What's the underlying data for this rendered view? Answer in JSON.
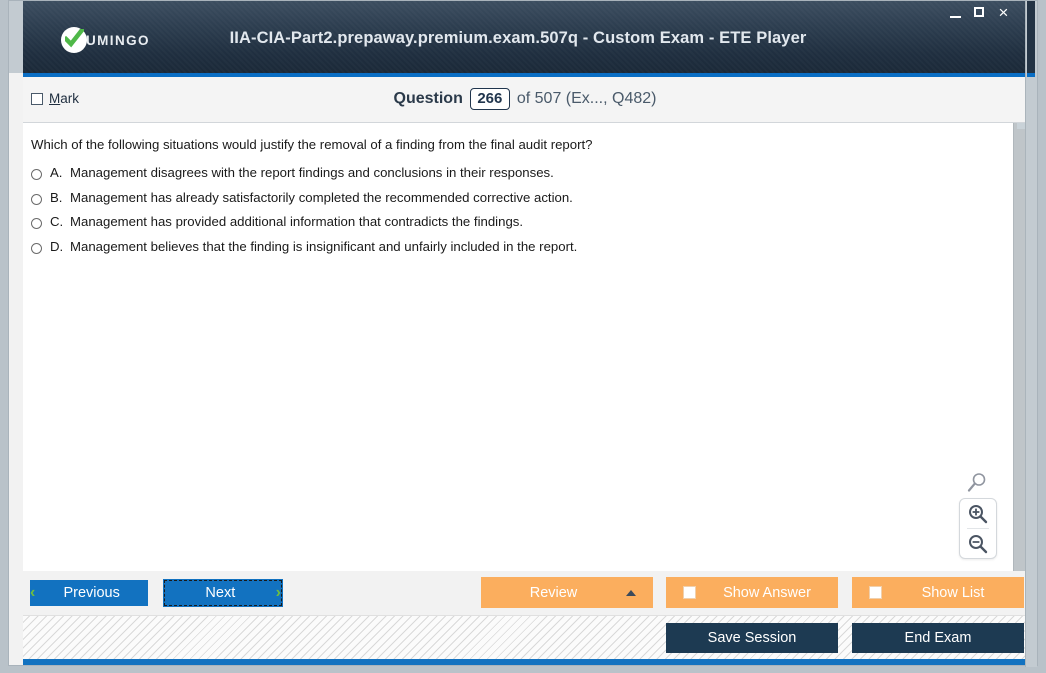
{
  "window": {
    "title": "IIA-CIA-Part2.prepaway.premium.exam.507q - Custom Exam - ETE Player",
    "logo_text": "UMINGO",
    "controls": {
      "minimize": "minimize",
      "maximize": "maximize",
      "close": "×"
    },
    "accent_blue": "#1272c0",
    "titlebar_dark": "#22303f"
  },
  "question_header": {
    "mark_label_accel": "M",
    "mark_label_rest": "ark",
    "question_word": "Question",
    "question_number": "266",
    "of_text": "of 507 (Ex..., Q482)",
    "marked": false
  },
  "question": {
    "prompt": "Which of the following situations would justify the removal of a finding from the final audit report?",
    "options": [
      {
        "letter": "A.",
        "text": "Management disagrees with the report findings and conclusions in their responses.",
        "selected": false
      },
      {
        "letter": "B.",
        "text": "Management has already satisfactorily completed the recommended corrective action.",
        "selected": false
      },
      {
        "letter": "C.",
        "text": "Management has provided additional information that contradicts the findings.",
        "selected": false
      },
      {
        "letter": "D.",
        "text": "Management believes that the finding is insignificant and unfairly included in the report.",
        "selected": false
      }
    ]
  },
  "zoom_widget": {
    "loupe_icon": "magnifier-icon",
    "zoom_in_icon": "zoom-in-icon",
    "zoom_out_icon": "zoom-out-icon"
  },
  "toolbar": {
    "previous_label": "Previous",
    "next_label": "Next",
    "review_label": "Review",
    "show_answer_label": "Show Answer",
    "show_list_label": "Show List",
    "nav_button_color": "#1272c0",
    "action_button_color": "#fbae5e"
  },
  "statusbar": {
    "save_session_label": "Save Session",
    "end_exam_label": "End Exam",
    "dark_button_color": "#1d3a52"
  }
}
